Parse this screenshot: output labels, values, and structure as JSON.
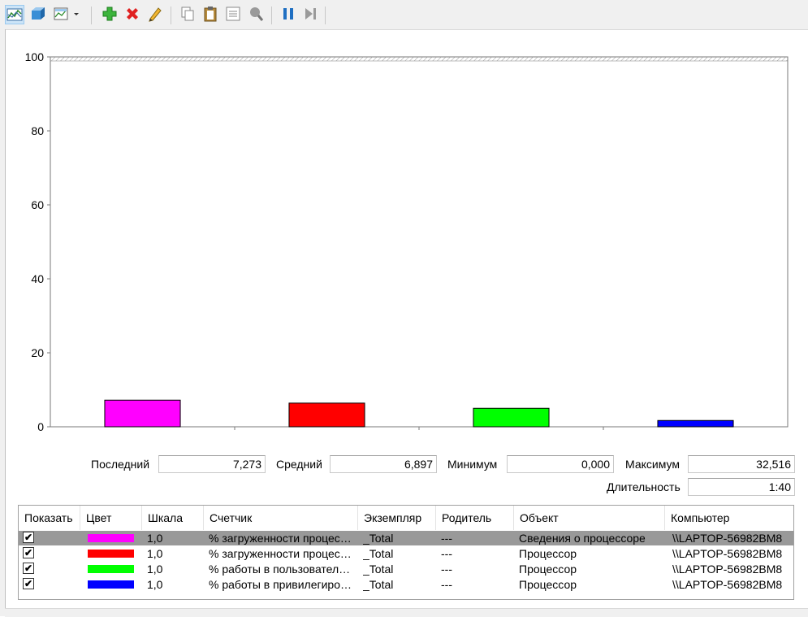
{
  "toolbar": {
    "icons": [
      "change-graph-type-icon",
      "view-current-data-icon",
      "change-graph-type-dropdown-icon",
      "add-counter-icon",
      "delete-counter-icon",
      "highlight-icon",
      "copy-properties-icon",
      "paste-counter-list-icon",
      "properties-icon",
      "zoom-icon",
      "freeze-display-icon",
      "update-data-icon"
    ]
  },
  "chart_data": {
    "type": "bar",
    "categories": [
      "% загруженности процес…",
      "% загруженности процес…",
      "% работы в пользовател…",
      "% работы в привилегиро…"
    ],
    "values": [
      7.2,
      6.4,
      5.0,
      1.7
    ],
    "colors": [
      "#ff00ff",
      "#ff0000",
      "#00ff00",
      "#0000ff"
    ],
    "ylim": [
      0,
      100
    ],
    "yticks": [
      0,
      20,
      40,
      60,
      80,
      100
    ],
    "grid": false
  },
  "stats": {
    "last_label": "Последний",
    "last_value": "7,273",
    "avg_label": "Средний",
    "avg_value": "6,897",
    "min_label": "Минимум",
    "min_value": "0,000",
    "max_label": "Максимум",
    "max_value": "32,516",
    "duration_label": "Длительность",
    "duration_value": "1:40"
  },
  "table": {
    "headers": [
      "Показать",
      "Цвет",
      "Шкала",
      "Счетчик",
      "Экземпляр",
      "Родитель",
      "Объект",
      "Компьютер"
    ],
    "rows": [
      {
        "show": "✔",
        "color": "#ff00ff",
        "scale": "1,0",
        "counter": "% загруженности процес…",
        "instance": "_Total",
        "parent": "---",
        "object": "Сведения о процессоре",
        "computer": "\\\\LAPTOP-56982BM8",
        "selected": true
      },
      {
        "show": "✔",
        "color": "#ff0000",
        "scale": "1,0",
        "counter": "% загруженности процес…",
        "instance": "_Total",
        "parent": "---",
        "object": "Процессор",
        "computer": "\\\\LAPTOP-56982BM8",
        "selected": false
      },
      {
        "show": "✔",
        "color": "#00ff00",
        "scale": "1,0",
        "counter": "% работы в пользовател…",
        "instance": "_Total",
        "parent": "---",
        "object": "Процессор",
        "computer": "\\\\LAPTOP-56982BM8",
        "selected": false
      },
      {
        "show": "✔",
        "color": "#0000ff",
        "scale": "1,0",
        "counter": "% работы в привилегиро…",
        "instance": "_Total",
        "parent": "---",
        "object": "Процессор",
        "computer": "\\\\LAPTOP-56982BM8",
        "selected": false
      }
    ]
  }
}
